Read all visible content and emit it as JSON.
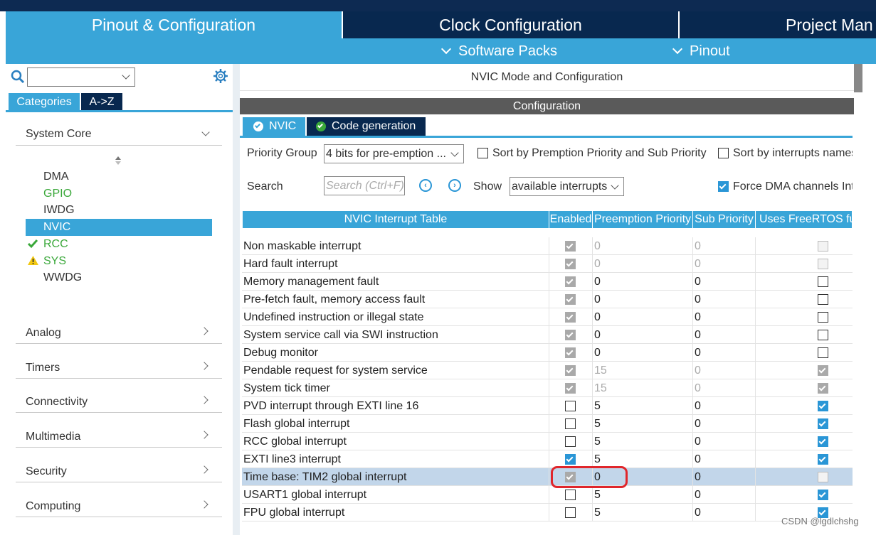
{
  "top_tabs": [
    {
      "label": "Pinout & Configuration"
    },
    {
      "label": "Clock Configuration"
    },
    {
      "label": "Project Man"
    }
  ],
  "sub_menu": [
    {
      "label": "Software Packs"
    },
    {
      "label": "Pinout"
    }
  ],
  "left": {
    "search_placeholder": "",
    "tabs": [
      {
        "label": "Categories"
      },
      {
        "label": "A->Z"
      }
    ],
    "system_core": "System Core",
    "peripherals": [
      {
        "label": "DMA",
        "status": "none",
        "color": "#333333"
      },
      {
        "label": "GPIO",
        "status": "none",
        "color": "#3aa83a"
      },
      {
        "label": "IWDG",
        "status": "none",
        "color": "#333333"
      },
      {
        "label": "NVIC",
        "status": "selected",
        "color": "#ffffff"
      },
      {
        "label": "RCC",
        "status": "ok",
        "color": "#3aa83a"
      },
      {
        "label": "SYS",
        "status": "warning",
        "color": "#3aa83a"
      },
      {
        "label": "WWDG",
        "status": "none",
        "color": "#333333"
      }
    ],
    "sections": [
      "Analog",
      "Timers",
      "Connectivity",
      "Multimedia",
      "Security",
      "Computing"
    ]
  },
  "mode_title": "NVIC Mode and Configuration",
  "config_title": "Configuration",
  "config_tabs": [
    {
      "label": "NVIC"
    },
    {
      "label": "Code generation"
    }
  ],
  "controls": {
    "priority_group_label": "Priority Group",
    "priority_group_value": "4 bits for pre-emption ...",
    "sort_preemption_label": "Sort by Premption Priority and Sub Priority",
    "sort_names_label": "Sort by interrupts names",
    "search_label": "Search",
    "search_placeholder": "Search (Ctrl+F)",
    "show_label": "Show",
    "show_value": "available interrupts",
    "force_dma_label": "Force DMA channels Int"
  },
  "table": {
    "headers": [
      "NVIC Interrupt Table",
      "Enabled",
      "Preemption Priority",
      "Sub Priority",
      "Uses FreeRTOS fu"
    ],
    "rows": [
      {
        "name": "Non maskable interrupt",
        "enabled": "fixed",
        "pre": "0",
        "sub": "0",
        "rtos": "grey",
        "dis": true
      },
      {
        "name": "Hard fault interrupt",
        "enabled": "fixed",
        "pre": "0",
        "sub": "0",
        "rtos": "grey",
        "dis": true
      },
      {
        "name": "Memory management fault",
        "enabled": "fixed",
        "pre": "0",
        "sub": "0",
        "rtos": "off",
        "dis": false
      },
      {
        "name": "Pre-fetch fault, memory access fault",
        "enabled": "fixed",
        "pre": "0",
        "sub": "0",
        "rtos": "off",
        "dis": false
      },
      {
        "name": "Undefined instruction or illegal state",
        "enabled": "fixed",
        "pre": "0",
        "sub": "0",
        "rtos": "off",
        "dis": false
      },
      {
        "name": "System service call via SWI instruction",
        "enabled": "fixed",
        "pre": "0",
        "sub": "0",
        "rtos": "off",
        "dis": false
      },
      {
        "name": "Debug monitor",
        "enabled": "fixed",
        "pre": "0",
        "sub": "0",
        "rtos": "off",
        "dis": false
      },
      {
        "name": "Pendable request for system service",
        "enabled": "fixed",
        "pre": "15",
        "sub": "0",
        "rtos": "greyon",
        "dis": true
      },
      {
        "name": "System tick timer",
        "enabled": "fixed",
        "pre": "15",
        "sub": "0",
        "rtos": "greyon",
        "dis": true
      },
      {
        "name": "PVD interrupt through EXTI line 16",
        "enabled": "off",
        "pre": "5",
        "sub": "0",
        "rtos": "on",
        "dis": false
      },
      {
        "name": "Flash global interrupt",
        "enabled": "off",
        "pre": "5",
        "sub": "0",
        "rtos": "on",
        "dis": false
      },
      {
        "name": "RCC global interrupt",
        "enabled": "off",
        "pre": "5",
        "sub": "0",
        "rtos": "on",
        "dis": false
      },
      {
        "name": "EXTI line3 interrupt",
        "enabled": "on",
        "pre": "5",
        "sub": "0",
        "rtos": "on",
        "dis": false
      },
      {
        "name": "Time base: TIM2 global interrupt",
        "enabled": "fixed",
        "pre": "0",
        "sub": "0",
        "rtos": "grey",
        "dis": false,
        "selected": true
      },
      {
        "name": "USART1 global interrupt",
        "enabled": "off",
        "pre": "5",
        "sub": "0",
        "rtos": "on",
        "dis": false
      },
      {
        "name": "FPU global interrupt",
        "enabled": "off",
        "pre": "5",
        "sub": "0",
        "rtos": "on",
        "dis": false
      }
    ]
  },
  "watermark": "CSDN @lgdlchshg",
  "colors": {
    "accent": "#39a5d8",
    "dark_nav": "#08284f",
    "check_blue": "#2a96d6",
    "highlight": "#e0262b"
  }
}
